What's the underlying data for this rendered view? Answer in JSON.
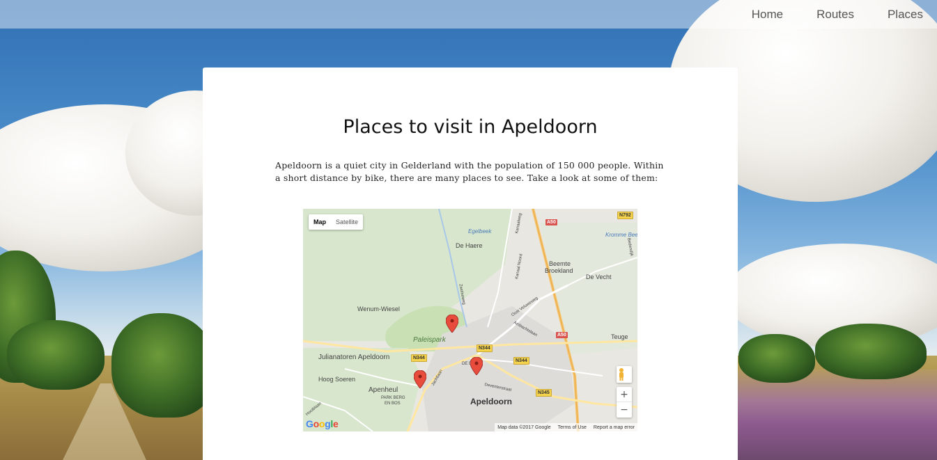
{
  "nav": {
    "items": [
      {
        "label": "Home"
      },
      {
        "label": "Routes"
      },
      {
        "label": "Places"
      }
    ]
  },
  "content": {
    "title": "Places to visit in Apeldoorn",
    "intro": "Apeldoorn is a quiet city in Gelderland with the population of 150 000 people. Within a short distance by bike, there are many places to see. Take a look at some of them:"
  },
  "map": {
    "type_controls": {
      "map": "Map",
      "satellite": "Satellite"
    },
    "zoom_in": "+",
    "zoom_out": "−",
    "logo": "Google",
    "footer": {
      "data": "Map data ©2017 Google",
      "terms": "Terms of Use",
      "report": "Report a map error"
    },
    "labels": {
      "de_haere": "De Haere",
      "beemte": "Beemte",
      "broekland": "Broekland",
      "de_vecht": "De Vecht",
      "wenum_wiesel": "Wenum-Wiesel",
      "paleispark": "Paleispark",
      "teuge": "Teuge",
      "julianatoren": "Julianatoren Apeldoorn",
      "hoog_soeren": "Hoog Soeren",
      "apenheul": "Apenheul",
      "park_berg": "PARK BERG",
      "en_bos": "EN BOS",
      "apeldoorn": "Apeldoorn",
      "egelbeek": "Egelbeek",
      "kromme_beek": "Kromme Beek",
      "de_gen": "DE  EN",
      "jachtlaan": "Jachtlaan",
      "deventerstraat": "Deventerstraat",
      "oost_veluweweg": "Oost Veluweweg",
      "kanaal_noord": "Kanaal Noord",
      "zwolseweg": "Zwolseweg",
      "kanaalweg": "Kanaalweg",
      "ambachtslaan": "Ambachtslaan",
      "hooiblaan": "Hooiblaan",
      "bedendijk": "Bedendijk"
    },
    "road_signs": {
      "a50_top": "A50",
      "a50_mid": "A50",
      "n792": "N792",
      "n344_a": "N344",
      "n344_b": "N344",
      "n344_c": "N344",
      "n345": "N345"
    },
    "colors": {
      "land": "#e9e7e1",
      "park": "#c8e0b4",
      "urban": "#dcdcd8",
      "highway": "#f6c36a",
      "road": "#ffffff",
      "pin": "#e74c3c"
    }
  }
}
